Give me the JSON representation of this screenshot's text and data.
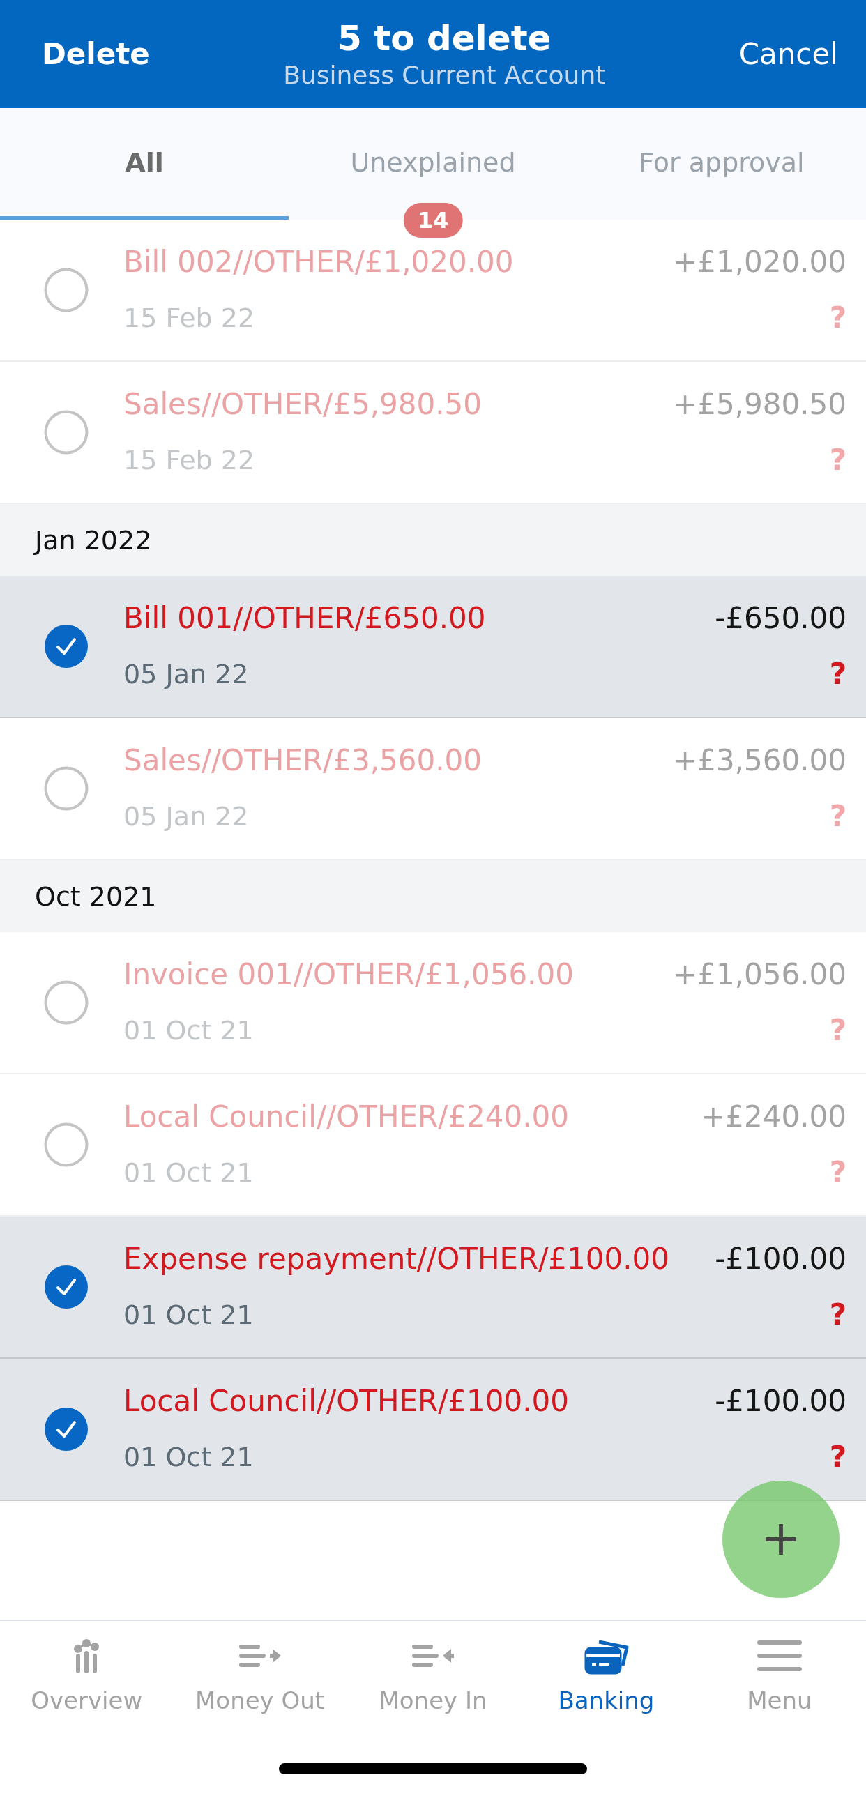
{
  "header": {
    "left_action": "Delete",
    "title": "5 to delete",
    "subtitle": "Business Current Account",
    "right_action": "Cancel"
  },
  "tabs": [
    {
      "label": "All",
      "selected": true
    },
    {
      "label": "Unexplained",
      "selected": false,
      "badge": "14"
    },
    {
      "label": "For approval",
      "selected": false
    }
  ],
  "list": [
    {
      "kind": "transaction",
      "description": "Bill 002//OTHER/£1,020.00",
      "date": "15 Feb 22",
      "amount": "+£1,020.00",
      "status": "?",
      "selected": false
    },
    {
      "kind": "transaction",
      "description": "Sales//OTHER/£5,980.50",
      "date": "15 Feb 22",
      "amount": "+£5,980.50",
      "status": "?",
      "selected": false
    },
    {
      "kind": "heading",
      "label": "Jan 2022"
    },
    {
      "kind": "transaction",
      "description": "Bill 001//OTHER/£650.00",
      "date": "05 Jan 22",
      "amount": "-£650.00",
      "status": "?",
      "selected": true
    },
    {
      "kind": "transaction",
      "description": "Sales//OTHER/£3,560.00",
      "date": "05 Jan 22",
      "amount": "+£3,560.00",
      "status": "?",
      "selected": false
    },
    {
      "kind": "heading",
      "label": "Oct 2021"
    },
    {
      "kind": "transaction",
      "description": "Invoice 001//OTHER/£1,056.00",
      "date": "01 Oct 21",
      "amount": "+£1,056.00",
      "status": "?",
      "selected": false
    },
    {
      "kind": "transaction",
      "description": "Local Council//OTHER/£240.00",
      "date": "01 Oct 21",
      "amount": "+£240.00",
      "status": "?",
      "selected": false
    },
    {
      "kind": "transaction",
      "description": "Expense repayment//OTHER/£100.00",
      "date": "01 Oct 21",
      "amount": "-£100.00",
      "status": "?",
      "selected": true
    },
    {
      "kind": "transaction",
      "description": "Local Council//OTHER/£100.00",
      "date": "01 Oct 21",
      "amount": "-£100.00",
      "status": "?",
      "selected": true
    }
  ],
  "nav": [
    {
      "kind": "overview",
      "label": "Overview",
      "selected": false
    },
    {
      "kind": "money_out",
      "label": "Money Out",
      "selected": false
    },
    {
      "kind": "money_in",
      "label": "Money In",
      "selected": false
    },
    {
      "kind": "banking",
      "label": "Banking",
      "selected": true
    },
    {
      "kind": "menu",
      "label": "Menu",
      "selected": false
    }
  ]
}
